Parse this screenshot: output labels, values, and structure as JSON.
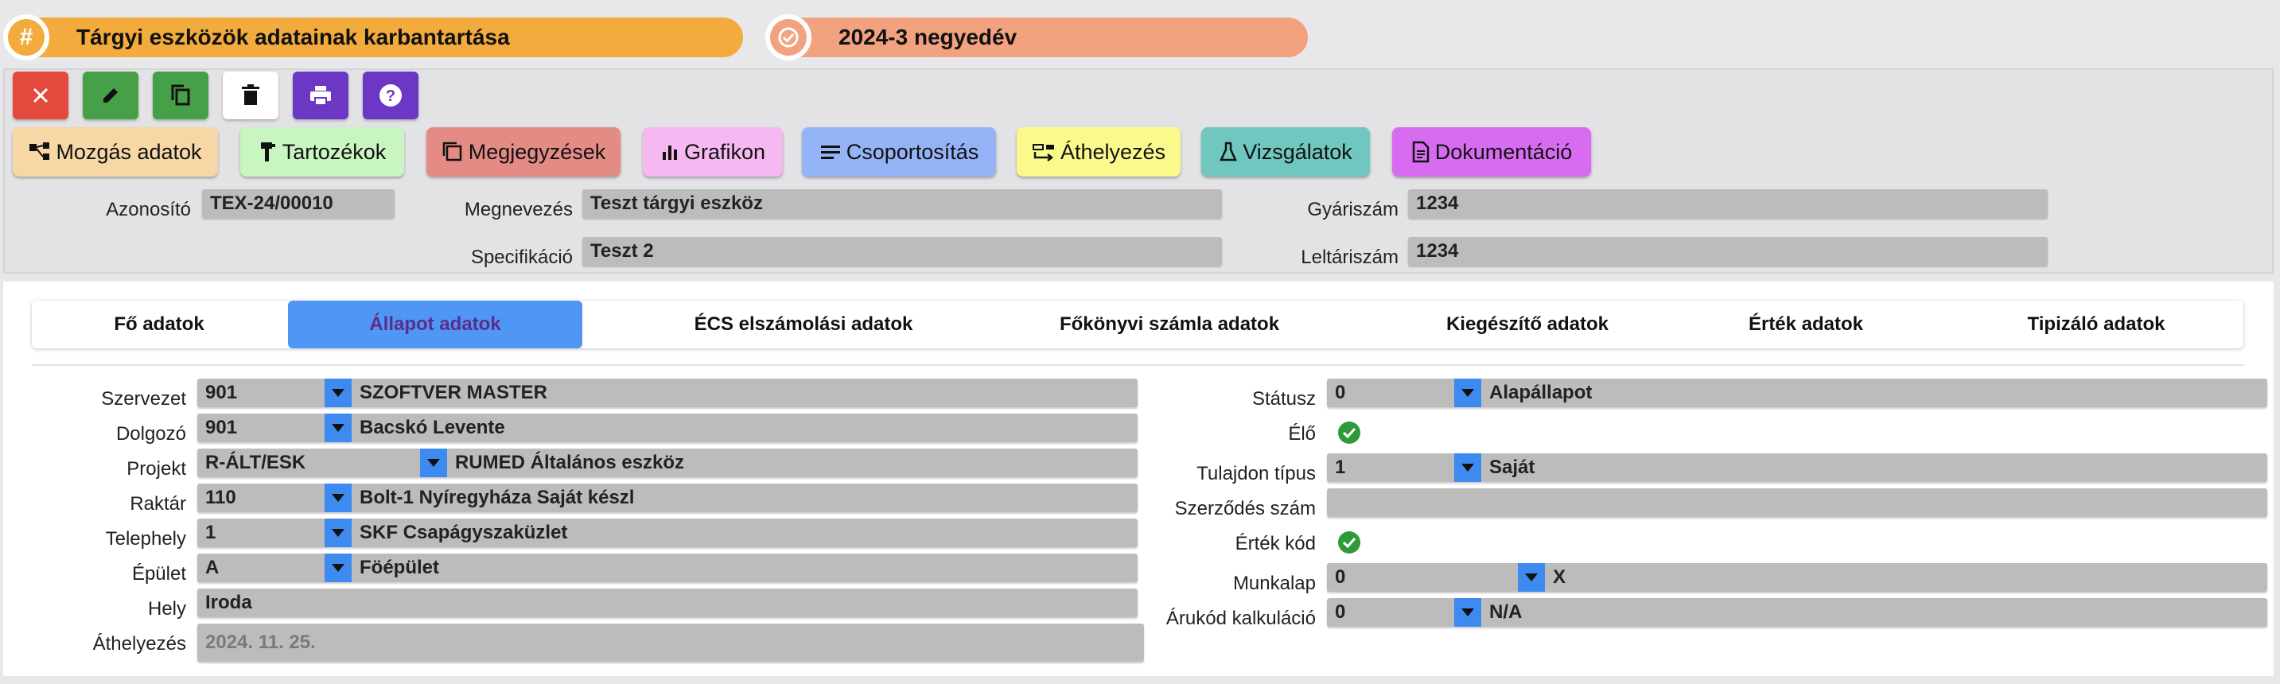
{
  "header": {
    "title": "Tárgyi eszközök adatainak karbantartása",
    "period": "2024-3 negyedév",
    "title_color": "#f2ab3c",
    "period_color": "#f2a27f"
  },
  "toolbar": {
    "icons": [
      "close-icon",
      "edit-icon",
      "copy-icon",
      "delete-icon",
      "print-icon",
      "help-icon"
    ]
  },
  "actions": [
    {
      "label": "Mozgás adatok",
      "icon": "hierarchy-icon",
      "color": "#f7d7a6"
    },
    {
      "label": "Tartozékok",
      "icon": "accessory-icon",
      "color": "#c9f5c0"
    },
    {
      "label": "Megjegyzések",
      "icon": "notes-icon",
      "color": "#e58b86"
    },
    {
      "label": "Grafikon",
      "icon": "chart-icon",
      "color": "#f5b8f0"
    },
    {
      "label": "Csoportosítás",
      "icon": "group-icon",
      "color": "#95b3f7"
    },
    {
      "label": "Áthelyezés",
      "icon": "move-icon",
      "color": "#fafa8c"
    },
    {
      "label": "Vizsgálatok",
      "icon": "flask-icon",
      "color": "#6fc7bf"
    },
    {
      "label": "Dokumentáció",
      "icon": "document-icon",
      "color": "#d86cf0"
    }
  ],
  "header_fields": {
    "azonosito": {
      "label": "Azonosító",
      "value": "TEX-24/00010"
    },
    "megnevezes": {
      "label": "Megnevezés",
      "value": "Teszt tárgyi eszköz"
    },
    "gyariszam": {
      "label": "Gyáriszám",
      "value": "1234"
    },
    "specifikacio": {
      "label": "Specifikáció",
      "value": "Teszt 2"
    },
    "leltariszam": {
      "label": "Leltáriszám",
      "value": "1234"
    }
  },
  "tabs": [
    {
      "label": "Fő adatok",
      "active": false
    },
    {
      "label": "Állapot adatok",
      "active": true
    },
    {
      "label": "ÉCS elszámolási adatok",
      "active": false
    },
    {
      "label": "Főkönyvi számla adatok",
      "active": false
    },
    {
      "label": "Kiegészítő adatok",
      "active": false
    },
    {
      "label": "Érték adatok",
      "active": false
    },
    {
      "label": "Tipizáló adatok",
      "active": false
    }
  ],
  "left_fields": [
    {
      "label": "Szervezet",
      "code": "901",
      "name": "SZOFTVER MASTER"
    },
    {
      "label": "Dolgozó",
      "code": "901",
      "name": "Bacskó Levente"
    },
    {
      "label": "Projekt",
      "code": "R-ÁLT/ESK",
      "name": "RUMED Általános eszköz"
    },
    {
      "label": "Raktár",
      "code": "110",
      "name": "Bolt-1 Nyíregyháza Saját készl"
    },
    {
      "label": "Telephely",
      "code": "1",
      "name": "SKF Csapágyszaküzlet"
    },
    {
      "label": "Épület",
      "code": "A",
      "name": "Föépület"
    },
    {
      "label": "Hely",
      "value": "Iroda"
    },
    {
      "label": "Áthelyezés",
      "value": "2024. 11. 25."
    }
  ],
  "right_fields": {
    "statusz": {
      "label": "Státusz",
      "code": "0",
      "name": "Alapállapot"
    },
    "elo": {
      "label": "Élő",
      "checked": true
    },
    "tulajdon": {
      "label": "Tulajdon típus",
      "code": "1",
      "name": "Saját"
    },
    "szerzodes": {
      "label": "Szerződés szám",
      "value": ""
    },
    "ertekkod": {
      "label": "Érték kód",
      "checked": true
    },
    "munkalap": {
      "label": "Munkalap",
      "code": "0",
      "name": "X"
    },
    "arukod": {
      "label": "Árukód kalkuláció",
      "code": "0",
      "name": "N/A"
    }
  }
}
